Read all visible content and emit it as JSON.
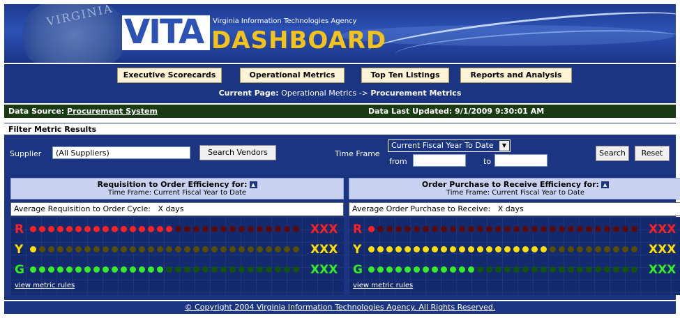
{
  "banner": {
    "seal_text": "VIRGINIA",
    "logo": "VITA",
    "agency": "Virginia Information Technologies Agency",
    "title": "DASHBOARD"
  },
  "nav": {
    "tabs": [
      {
        "label": "Executive Scorecards"
      },
      {
        "label": "Operational Metrics"
      },
      {
        "label": "Top Ten Listings"
      },
      {
        "label": "Reports and Analysis"
      }
    ],
    "current_page_label": "Current Page:",
    "current_page_path": "Operational Metrics ->",
    "current_page_name": "Procurement Metrics"
  },
  "status": {
    "data_source_label": "Data Source:",
    "data_source": "Procurement System",
    "last_updated": "Data Last Updated: 9/1/2009 9:30:01 AM"
  },
  "filter": {
    "heading": "Filter Metric Results",
    "supplier_label": "Supplier",
    "supplier_value": "(All Suppliers)",
    "search_vendors": "Search Vendors",
    "time_frame_label": "Time Frame",
    "time_frame_value": "Current Fiscal Year To Date",
    "from_label": "from",
    "from_value": "",
    "to_label": "to",
    "to_value": "",
    "search": "Search",
    "reset": "Reset"
  },
  "panels": [
    {
      "title": "Requisition to Order Efficiency for:",
      "time_frame": "Time Frame: Current Fiscal Year to Date",
      "avg_label": "Average Requisition to Order Cycle:",
      "avg_value": "X days",
      "rows": [
        {
          "letter": "R",
          "value": "XXX",
          "color": "#ff2020",
          "filled": 16,
          "total": 30
        },
        {
          "letter": "Y",
          "value": "XXX",
          "color": "#ffe000",
          "filled": 1,
          "total": 30
        },
        {
          "letter": "G",
          "value": "XXX",
          "color": "#33ee22",
          "filled": 15,
          "total": 30
        }
      ],
      "link": "view metric rules"
    },
    {
      "title": "Order Purchase to Receive Efficiency for:",
      "time_frame": "Time Frame: Current Fiscal Year to Date",
      "avg_label": "Average Order Purchase to Receive:",
      "avg_value": "X days",
      "rows": [
        {
          "letter": "R",
          "value": "XXX",
          "color": "#ff2020",
          "filled": 1,
          "total": 30
        },
        {
          "letter": "Y",
          "value": "XXX",
          "color": "#ffe000",
          "filled": 20,
          "total": 30
        },
        {
          "letter": "G",
          "value": "XXX",
          "color": "#33ee22",
          "filled": 12,
          "total": 30
        }
      ],
      "link": "view metric rules"
    }
  ],
  "footer": {
    "copyright": "© Copyright 2004 Virginia Information Technologies Agency. All Rights Reserved."
  },
  "colors": {
    "nav_blue": "#1b3583",
    "tab_bg": "#fdf3d7",
    "status_green": "#1a3a14",
    "panel_header": "#c9d3f1",
    "dashboard_gold": "#f3c21b"
  }
}
